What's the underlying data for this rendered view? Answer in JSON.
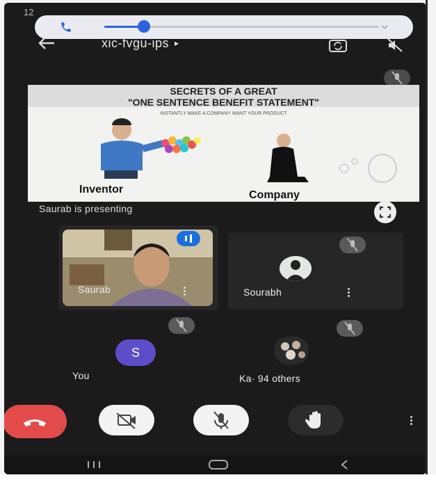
{
  "status": {
    "time": "12"
  },
  "header": {
    "meeting_code": "xic-fvgu-ips",
    "chevron": "▸"
  },
  "slide": {
    "title_line1": "SECRETS OF A GREAT",
    "title_line2": "\"ONE SENTENCE BENEFIT STATEMENT\"",
    "subtitle": "INSTANTLY MAKE A COMPANY WANT YOUR PRODUCT",
    "label_left": "Inventor",
    "label_right": "Company"
  },
  "presenting_text": "Saurab is presenting",
  "participants": [
    {
      "name": "Saurab"
    },
    {
      "name": "Sourabh"
    },
    {
      "name": "You",
      "initial": "S"
    },
    {
      "name": "Ka· 94 others"
    }
  ],
  "colors": {
    "end_call": "#e34b4b",
    "accent": "#2a62e0",
    "avatar": "#5b4ec8"
  },
  "icons": [
    "phone-icon",
    "chevron-down-icon",
    "back-arrow-icon",
    "camera-switch-icon",
    "speaker-off-icon",
    "mic-off-icon",
    "fullscreen-icon",
    "more-vert-icon",
    "end-call-icon",
    "camera-off-icon",
    "raise-hand-icon",
    "nav-recents-icon",
    "nav-home-icon",
    "nav-back-icon"
  ]
}
